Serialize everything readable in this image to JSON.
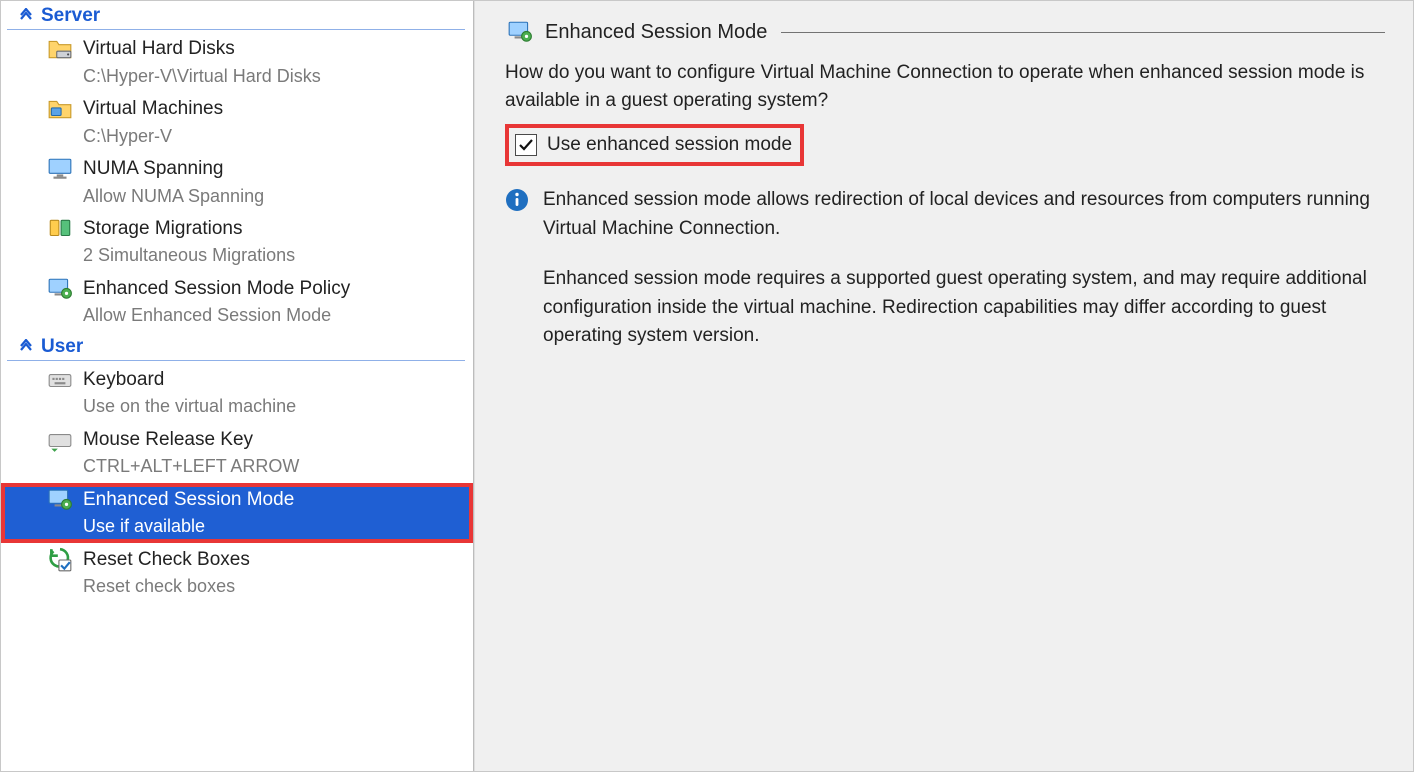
{
  "nav": {
    "sections": [
      {
        "key": "server",
        "label": "Server",
        "items": [
          {
            "key": "vhd",
            "title": "Virtual Hard Disks",
            "subtitle": "C:\\Hyper-V\\Virtual Hard Disks",
            "icon": "folder-disk-icon"
          },
          {
            "key": "vm",
            "title": "Virtual Machines",
            "subtitle": "C:\\Hyper-V",
            "icon": "folder-vm-icon"
          },
          {
            "key": "numa",
            "title": "NUMA Spanning",
            "subtitle": "Allow NUMA Spanning",
            "icon": "monitor-icon"
          },
          {
            "key": "storage",
            "title": "Storage Migrations",
            "subtitle": "2 Simultaneous Migrations",
            "icon": "drive-move-icon"
          },
          {
            "key": "esm-policy",
            "title": "Enhanced Session Mode Policy",
            "subtitle": "Allow Enhanced Session Mode",
            "icon": "monitor-gear-icon"
          }
        ]
      },
      {
        "key": "user",
        "label": "User",
        "items": [
          {
            "key": "keyboard",
            "title": "Keyboard",
            "subtitle": "Use on the virtual machine",
            "icon": "keyboard-icon"
          },
          {
            "key": "mouse-release",
            "title": "Mouse Release Key",
            "subtitle": "CTRL+ALT+LEFT ARROW",
            "icon": "keyboard-arrow-icon"
          },
          {
            "key": "esm",
            "title": "Enhanced Session Mode",
            "subtitle": "Use if available",
            "icon": "monitor-gear-icon",
            "selected": true,
            "highlighted": true
          },
          {
            "key": "reset",
            "title": "Reset Check Boxes",
            "subtitle": "Reset check boxes",
            "icon": "reset-check-icon"
          }
        ]
      }
    ]
  },
  "pane": {
    "title": "Enhanced Session Mode",
    "question": "How do you want to configure Virtual Machine Connection to operate when enhanced session mode is available in a guest operating system?",
    "checkbox_label": "Use enhanced session mode",
    "checkbox_checked": true,
    "info_p1": "Enhanced session mode allows redirection of local devices and resources from computers running Virtual Machine Connection.",
    "info_p2": "Enhanced session mode requires a supported guest operating system, and may require additional configuration inside the virtual machine. Redirection capabilities may differ according to guest operating system version."
  }
}
